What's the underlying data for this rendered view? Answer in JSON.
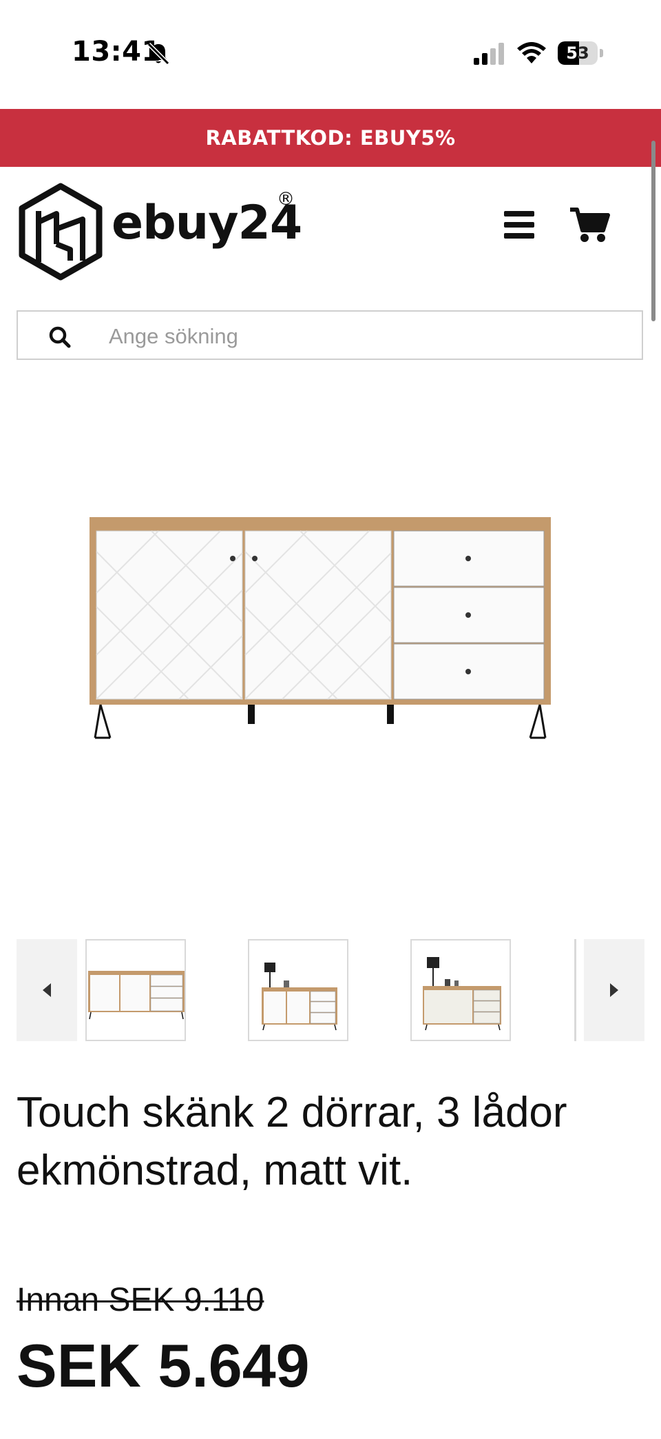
{
  "status_bar": {
    "time": "13:41",
    "battery": "53",
    "battery_level": 0.53,
    "icons": [
      "bell-slash-icon",
      "signal-icon",
      "wifi-icon",
      "battery-icon"
    ]
  },
  "promo": {
    "text": "RABATTKOD: EBUY5%",
    "background": "#c8303f"
  },
  "header": {
    "logo_text": "ebuy24",
    "logo_registered": "®",
    "menu_icon": "hamburger-menu-icon",
    "cart_icon": "cart-icon"
  },
  "search": {
    "placeholder": "Ange sökning",
    "value": "",
    "icon": "search-icon"
  },
  "gallery": {
    "prev_icon": "chevron-left-icon",
    "next_icon": "chevron-right-icon",
    "thumbnails": [
      "thumbnail-1",
      "thumbnail-2",
      "thumbnail-3"
    ]
  },
  "product": {
    "title": "Touch skänk 2 dörrar, 3 lådor ekmönstrad, matt vit.",
    "old_price": "Innan SEK 9.110",
    "price": "SEK 5.649"
  },
  "colors": {
    "accent": "#c8303f",
    "text": "#111111",
    "wood": "#c49a6c",
    "white_panel": "#fafafa"
  }
}
